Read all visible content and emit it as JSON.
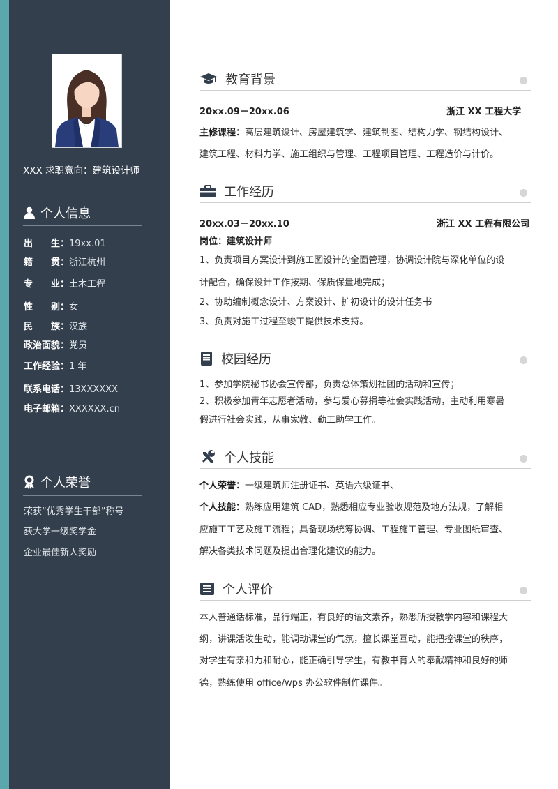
{
  "sidebar": {
    "job_title": "XXX 求职意向：建筑设计师",
    "info_heading": "个人信息",
    "info": [
      {
        "label": "出　　生：",
        "value": "19xx.01"
      },
      {
        "label": "籍　　贯：",
        "value": "浙江杭州"
      },
      {
        "label": "专　　业：",
        "value": "土木工程"
      },
      {
        "label": "性　　别：",
        "value": "女"
      },
      {
        "label": "民　　族：",
        "value": "汉族"
      },
      {
        "label": "政治面貌：",
        "value": "党员"
      },
      {
        "label": "工作经验：",
        "value": "1 年"
      },
      {
        "label": "联系电话：",
        "value": "13XXXXXX"
      },
      {
        "label": "电子邮箱：",
        "value": "XXXXXX.cn"
      }
    ],
    "honor_heading": "个人荣誉",
    "honors": [
      "荣获“优秀学生干部”称号",
      "获大学一级奖学金",
      "企业最佳新人奖励"
    ]
  },
  "education": {
    "heading": "教育背景",
    "period": "20xx.09－20xx.06",
    "school": "浙江 XX 工程大学",
    "courses_label": "主修课程：",
    "courses_line1": "高层建筑设计、房屋建筑学、建筑制图、结构力学、钢结构设计、",
    "courses_line2": "建筑工程、材料力学、施工组织与管理、工程项目管理、工程造价与计价。"
  },
  "work": {
    "heading": "工作经历",
    "period": "20xx.03－20xx.10",
    "company": "浙江 XX 工程有限公司",
    "position": "岗位：建筑设计师",
    "lines": [
      "1、负责项目方案设计到施工图设计的全面管理，协调设计院与深化单位的设",
      "计配合，确保设计工作按期、保质保量地完成；",
      "2、协助编制概念设计、方案设计、扩初设计的设计任务书",
      "3、负责对施工过程至竣工提供技术支持。"
    ]
  },
  "campus": {
    "heading": "校园经历",
    "lines": [
      "1、参加学院秘书协会宣传部，负责总体策划社团的活动和宣传；",
      "2、积极参加青年志愿者活动，参与爱心募捐等社会实践活动，主动利用寒暑",
      "假进行社会实践，从事家教、勤工助学工作。"
    ]
  },
  "skills": {
    "heading": "个人技能",
    "honor_label": "个人荣誉：",
    "honor_text": "一级建筑师注册证书、英语六级证书、",
    "skill_label": "个人技能：",
    "skill_line1": "熟练应用建筑 CAD，熟悉相应专业验收规范及地方法规，了解相",
    "skill_line2": "应施工工艺及施工流程；具备现场统筹协调、工程施工管理、专业图纸审查、",
    "skill_line3": "解决各类技术问题及提出合理化建议的能力。"
  },
  "evaluation": {
    "heading": "个人评价",
    "lines": [
      "本人普通话标准，品行端正，有良好的语文素养，熟悉所授教学内容和课程大",
      "纲，讲课活泼生动，能调动课堂的气氛，擅长课堂互动，能把控课堂的秩序，",
      "对学生有亲和力和耐心，能正确引导学生，有教书育人的奉献精神和良好的师",
      "德，熟练使用 office/wps 办公软件制作课件。"
    ]
  },
  "colors": {
    "sidebar": "#333f4d",
    "accent": "#5aa7ae"
  }
}
